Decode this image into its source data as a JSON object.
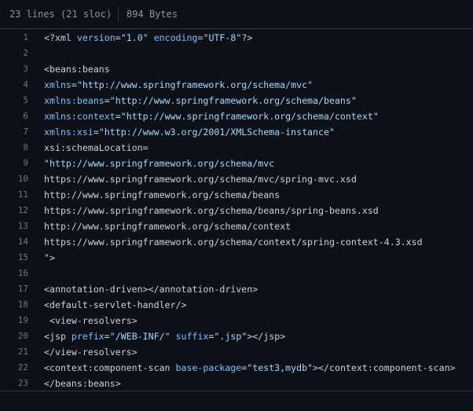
{
  "file_info": {
    "lines": "23 lines (21 sloc)",
    "size": "894 Bytes"
  },
  "code": {
    "line_numbers": [
      "1",
      "2",
      "3",
      "4",
      "5",
      "6",
      "7",
      "8",
      "9",
      "10",
      "11",
      "12",
      "13",
      "14",
      "15",
      "16",
      "17",
      "18",
      "19",
      "20",
      "21",
      "22",
      "23"
    ],
    "lines": [
      "<?xml version=\"1.0\" encoding=\"UTF-8\"?>",
      "",
      "<beans:beans",
      "xmlns=\"http://www.springframework.org/schema/mvc\"",
      "xmlns:beans=\"http://www.springframework.org/schema/beans\"",
      "xmlns:context=\"http://www.springframework.org/schema/context\"",
      "xmlns:xsi=\"http://www.w3.org/2001/XMLSchema-instance\"",
      "xsi:schemaLocation=",
      "\"http://www.springframework.org/schema/mvc",
      "https://www.springframework.org/schema/mvc/spring-mvc.xsd",
      "http://www.springframework.org/schema/beans",
      "https://www.springframework.org/schema/beans/spring-beans.xsd",
      "http://www.springframework.org/schema/context",
      "https://www.springframework.org/schema/context/spring-context-4.3.xsd",
      "\">",
      "",
      "<annotation-driven></annotation-driven>",
      "<default-servlet-handler/>",
      " <view-resolvers>",
      "<jsp prefix=\"/WEB-INF/\" suffix=\".jsp\"></jsp>",
      "</view-resolvers>",
      "<context:component-scan base-package=\"test3,mydb\"></context:component-scan>",
      "</beans:beans>"
    ]
  },
  "colors": {
    "background": "#0d1117",
    "text": "#c9d1d9",
    "line_number": "#6e7681",
    "border": "#30363d",
    "attribute": "#79c0ff",
    "string": "#a5d6ff"
  }
}
